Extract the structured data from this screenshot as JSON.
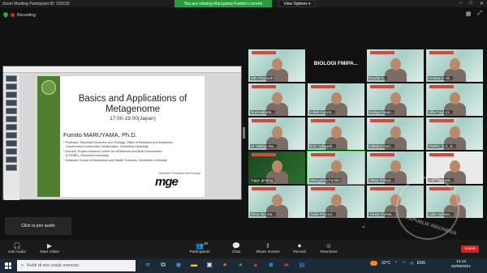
{
  "window": {
    "title": "Zoom Meeting Participant ID: 193130"
  },
  "banner": {
    "text": "You are viewing Maruyama Fumito's screen",
    "view_options": "View Options ▾"
  },
  "recording": {
    "label": "Recording"
  },
  "slide": {
    "title_line1": "Basics and Applications of",
    "title_line2": "Metagenome",
    "time": "17:00-19:00(Japan)",
    "speaker": "Fumito MARUYAMA, Ph.D.",
    "bullets": [
      "* Professor, Microbial Genomics and Ecology, Office of Research and Academia-",
      "Government-Community Collaboration, Hiroshima University",
      "* Director, Project research Center for HOlobiome and Built Environment",
      "(CHOBE), Hiroshima University",
      "* Graduate School of Biomedical and Health Sciences, Hiroshima University"
    ],
    "logo_caption": "Microbial Genomics and Ecology",
    "logo_text": "mge"
  },
  "gallery": [
    {
      "name": "MD Ahwanah",
      "style": "normal"
    },
    {
      "name": "BIOLOGI FMIPA...",
      "style": "black"
    },
    {
      "name": "Naufal A...",
      "style": "normal"
    },
    {
      "name": "Annisa A. Ali...",
      "style": "normal"
    },
    {
      "name": "Nurmadiarta...",
      "style": "normal"
    },
    {
      "name": "Indah Kurum...",
      "style": "normal"
    },
    {
      "name": "Nadya Faran...",
      "style": "normal"
    },
    {
      "name": "Alfia Fajri Ut...",
      "style": "normal"
    },
    {
      "name": "M. Wahyu Sa...",
      "style": "normal"
    },
    {
      "name": "B.D. Udayath...",
      "style": "normal"
    },
    {
      "name": "Mifathul Hud...",
      "style": "normal"
    },
    {
      "name": "FMIPA_E.C_S...",
      "style": "normal"
    },
    {
      "name": "inggo gintang",
      "style": "green"
    },
    {
      "name": "Maruyama Fumito",
      "style": "speaker"
    },
    {
      "name": "Akbar Rokya...",
      "style": "normal"
    },
    {
      "name": "Indri Agarwal...",
      "style": "white"
    },
    {
      "name": "Wina Nur Sa...",
      "style": "normal"
    },
    {
      "name": "Aoka Fina Le...",
      "style": "normal"
    },
    {
      "name": "Yuniar Kurwa...",
      "style": "normal"
    },
    {
      "name": "Laila Sahara...",
      "style": "normal"
    }
  ],
  "audio_popup": {
    "text": "Click to join audio"
  },
  "controls": {
    "join_audio": "Join Audio",
    "start_video": "Start Video",
    "participants": "Participants",
    "participants_count": "28",
    "chat": "Chat",
    "share_screen": "Share Screen",
    "record": "Record",
    "reactions": "Reactions",
    "leave": "Leave"
  },
  "watermark": {
    "text": "REPUBLIK INDONESIA",
    "text2": "PRESIDEN"
  },
  "taskbar": {
    "search_placeholder": "Ketik di sini untuk mencari",
    "temperature": "32°C",
    "language": "ENG",
    "time": "13:13",
    "date": "02/08/2021"
  }
}
